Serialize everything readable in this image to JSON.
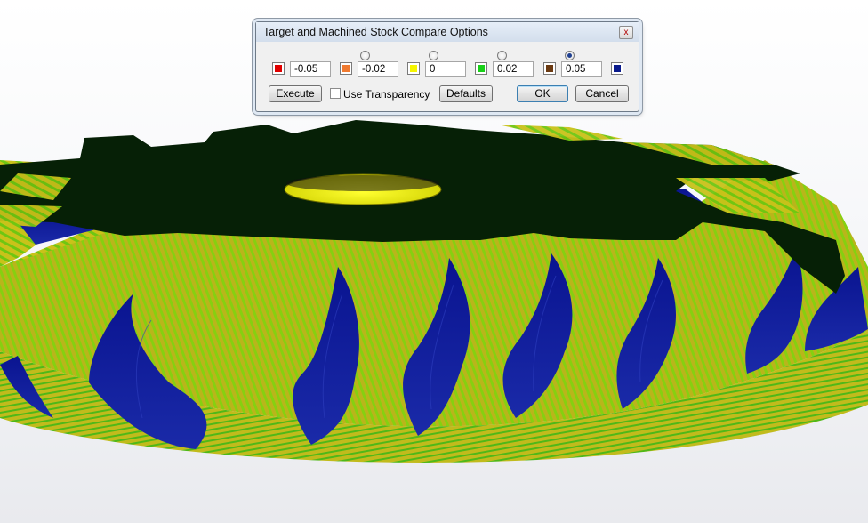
{
  "dialog": {
    "title": "Target and Machined Stock Compare Options",
    "close_glyph": "x",
    "tolerances": [
      {
        "value": "-0.05",
        "color": "#e00000"
      },
      {
        "value": "-0.02",
        "color": "#f07a30"
      },
      {
        "value": "0",
        "color": "#f5f500"
      },
      {
        "value": "0.02",
        "color": "#18d018"
      },
      {
        "value": "0.05",
        "color": "#6b3a12"
      }
    ],
    "last_color": "#0a1a8c",
    "radio_selected_index": 3,
    "buttons": {
      "execute": "Execute",
      "defaults": "Defaults",
      "ok": "OK",
      "cancel": "Cancel"
    },
    "transparency_label": "Use Transparency",
    "transparency_checked": false
  },
  "scene": {
    "colors": {
      "top_face": "#062006",
      "flank_stripe_a": "#7fcf12",
      "flank_stripe_b": "#c9c21a",
      "groove": "#0a138f",
      "groove_edge": "#14239e",
      "side_band": "#b8b520",
      "bore": "#f0f000"
    }
  }
}
